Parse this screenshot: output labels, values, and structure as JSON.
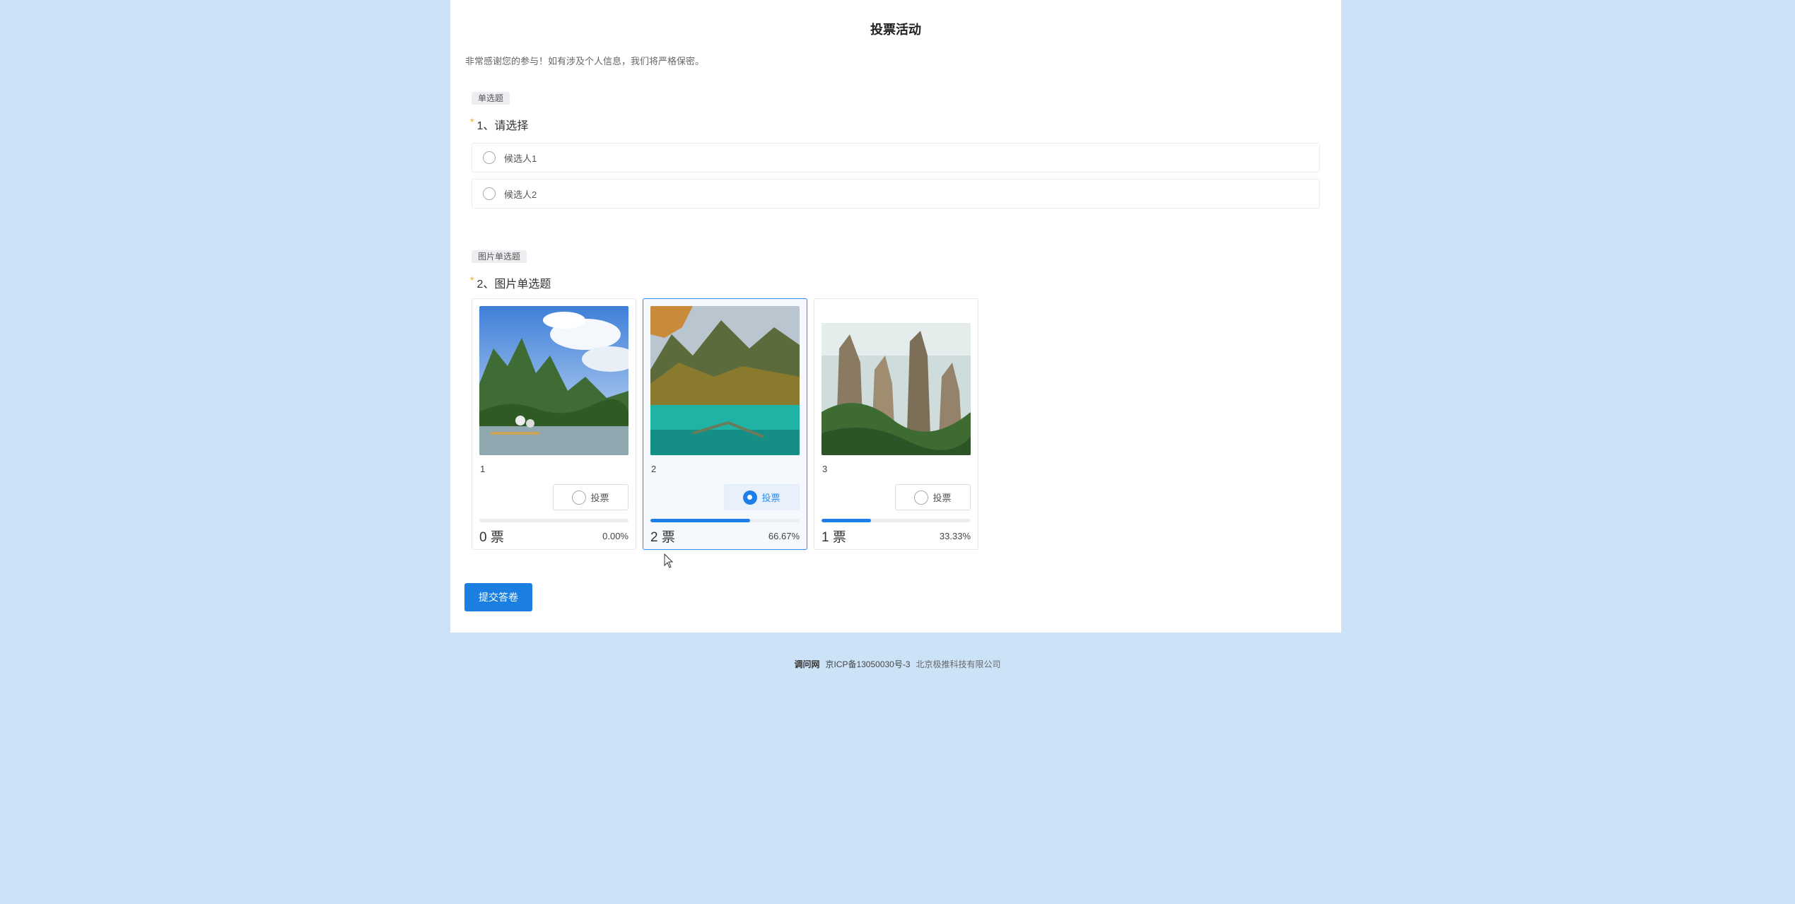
{
  "page": {
    "title": "投票活动",
    "intro": "非常感谢您的参与！如有涉及个人信息，我们将严格保密。"
  },
  "question1": {
    "tag": "单选题",
    "required_mark": "*",
    "title": "1、请选择",
    "options": [
      {
        "label": "候选人1",
        "selected": false
      },
      {
        "label": "候选人2",
        "selected": false
      }
    ]
  },
  "question2": {
    "tag": "图片单选题",
    "required_mark": "*",
    "title": "2、图片单选题",
    "vote_label": "投票",
    "cards": [
      {
        "name": "1",
        "votes": "0 票",
        "percent": "0.00%",
        "fraction": 0.0,
        "selected": false,
        "image": "karst-river-landscape"
      },
      {
        "name": "2",
        "votes": "2 票",
        "percent": "66.67%",
        "fraction": 0.6667,
        "selected": true,
        "image": "turquoise-lake-autumn"
      },
      {
        "name": "3",
        "votes": "1 票",
        "percent": "33.33%",
        "fraction": 0.3333,
        "selected": false,
        "image": "sandstone-pillars"
      }
    ]
  },
  "submit_label": "提交答卷",
  "footer": {
    "brand": "调问网",
    "icp": "京ICP备13050030号-3",
    "company": "北京极推科技有限公司"
  },
  "colors": {
    "background": "#cce3f7",
    "accent": "#1a7fe0",
    "required": "#f5a623"
  }
}
